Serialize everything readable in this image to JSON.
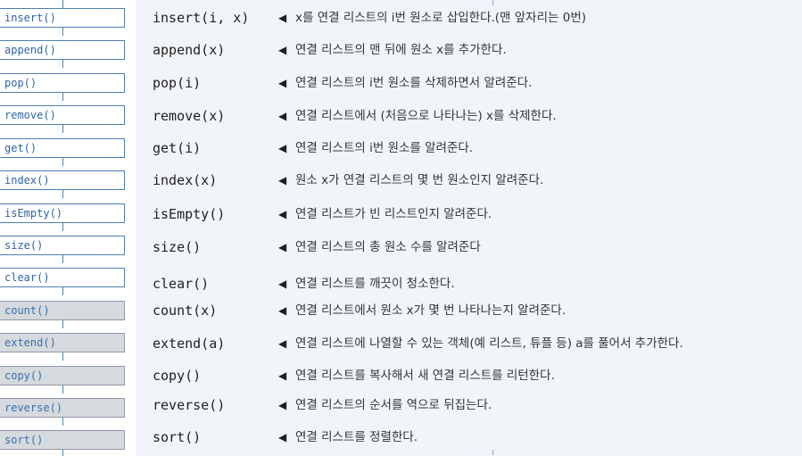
{
  "sidebar": {
    "items": [
      {
        "label": "insert()"
      },
      {
        "label": "append()"
      },
      {
        "label": "pop()"
      },
      {
        "label": "remove()"
      },
      {
        "label": "get()"
      },
      {
        "label": "index()"
      },
      {
        "label": "isEmpty()"
      },
      {
        "label": "size()"
      },
      {
        "label": "clear()"
      },
      {
        "label": "count()"
      },
      {
        "label": "extend()"
      },
      {
        "label": "copy()"
      },
      {
        "label": "reverse()"
      },
      {
        "label": "sort()"
      }
    ]
  },
  "rows": [
    {
      "method": "insert(i, x)",
      "desc": "x를 연결 리스트의 i번 원소로 삽입한다.(맨 앞자리는 0번)"
    },
    {
      "method": "append(x)",
      "desc": "연결 리스트의 맨 뒤에 원소 x를 추가한다."
    },
    {
      "method": "pop(i)",
      "desc": "연결 리스트의 i번 원소를 삭제하면서 알려준다."
    },
    {
      "method": "remove(x)",
      "desc": "연결 리스트에서 (처음으로 나타나는) x를 삭제한다."
    },
    {
      "method": "get(i)",
      "desc": "연결 리스트의 i번 원소를 알려준다."
    },
    {
      "method": "index(x)",
      "desc": "원소 x가 연결 리스트의 몇 번 원소인지 알려준다."
    },
    {
      "method": "isEmpty()",
      "desc": "연결 리스트가 빈 리스트인지 알려준다."
    },
    {
      "method": "size()",
      "desc": "연결 리스트의 총 원소 수를 알려준다"
    },
    {
      "method": "clear()",
      "desc": "연결 리스트를 깨끗이 청소한다."
    },
    {
      "method": "count(x)",
      "desc": "연결 리스트에서 원소 x가 몇 번 나타나는지 알려준다."
    },
    {
      "method": "extend(a)",
      "desc": "연결 리스트에 나열할 수 있는 객체(예 리스트, 튜플 등) a를 풀어서 추가한다."
    },
    {
      "method": "copy()",
      "desc": "연결 리스트를 복사해서 새 연결 리스트를 리턴한다."
    },
    {
      "method": "reverse()",
      "desc": "연결 리스트의 순서를 역으로 뒤집는다."
    },
    {
      "method": "sort()",
      "desc": "연결 리스트를 정렬한다."
    }
  ],
  "arrow_glyph": "◀",
  "colors": {
    "panel_bg": "#f1f5fa",
    "pill_border": "#4f7fae",
    "pill_text": "#2f64a8",
    "pill_gray_bg": "#d6d9dd"
  }
}
